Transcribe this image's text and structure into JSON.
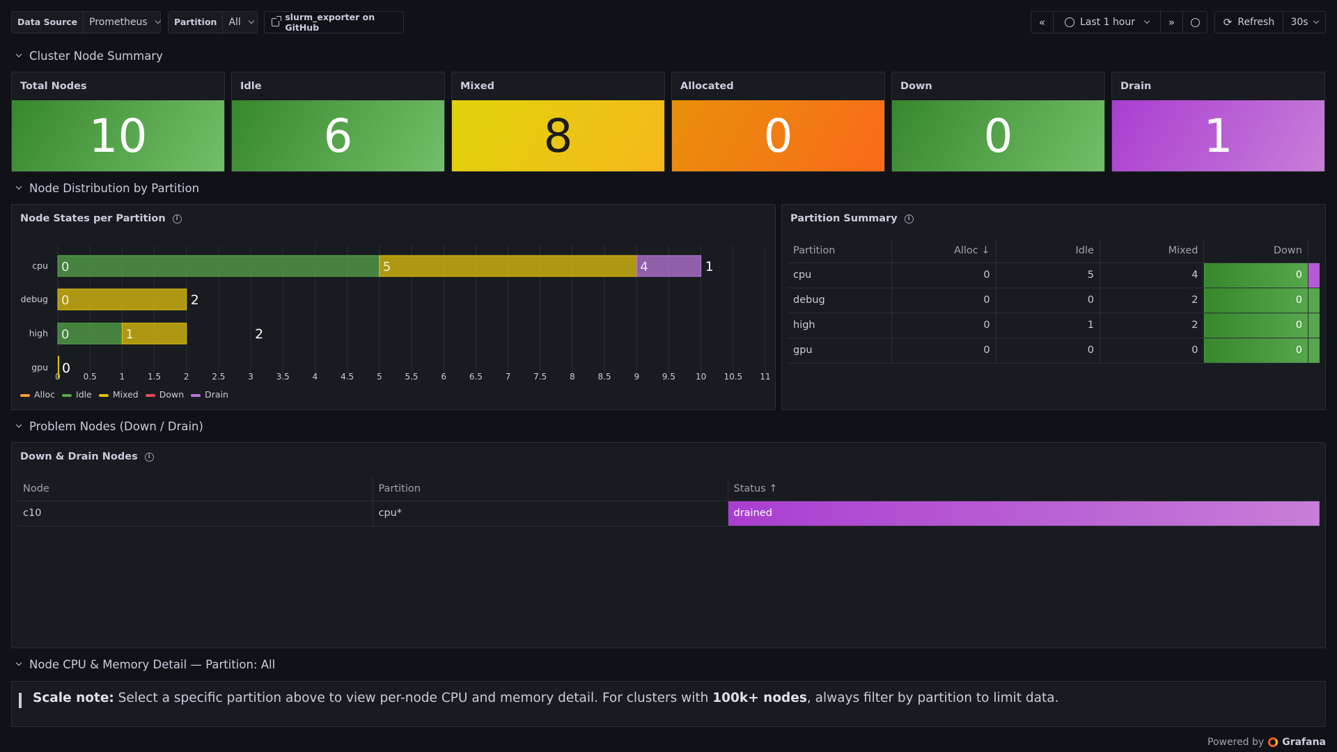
{
  "vars": {
    "datasource_label": "Data Source",
    "datasource_value": "Prometheus",
    "partition_label": "Partition",
    "partition_value": "All",
    "github_link": "slurm_exporter on GitHub"
  },
  "time": {
    "range": "Last 1 hour",
    "refresh": "Refresh",
    "interval": "30s"
  },
  "rows": {
    "summary": "Cluster Node Summary",
    "distribution": "Node Distribution by Partition",
    "problem": "Problem Nodes (Down / Drain)",
    "detail": "Node CPU & Memory Detail — Partition: All"
  },
  "stats": [
    {
      "title": "Total Nodes",
      "value": "10",
      "color": "#56a64b"
    },
    {
      "title": "Idle",
      "value": "6",
      "color": "#56a64b"
    },
    {
      "title": "Mixed",
      "value": "8",
      "color": "#f2cc0c"
    },
    {
      "title": "Allocated",
      "value": "0",
      "color": "#ff780a"
    },
    {
      "title": "Down",
      "value": "0",
      "color": "#56a64b"
    },
    {
      "title": "Drain",
      "value": "1",
      "color": "#b45ad2"
    }
  ],
  "bar_panel": {
    "title": "Node States per Partition"
  },
  "chart_data": {
    "type": "bar",
    "orientation": "horizontal",
    "stacked": true,
    "categories": [
      "cpu",
      "debug",
      "high",
      "gpu"
    ],
    "series": [
      {
        "name": "Alloc",
        "values": [
          0,
          0,
          0,
          0
        ],
        "color": "#ff9830"
      },
      {
        "name": "Idle",
        "values": [
          5,
          0,
          1,
          0
        ],
        "color": "#56a64b"
      },
      {
        "name": "Mixed",
        "values": [
          4,
          2,
          1,
          0
        ],
        "color": "#e0c10f"
      },
      {
        "name": "Down",
        "values": [
          0,
          0,
          0,
          0
        ],
        "color": "#f2495c"
      },
      {
        "name": "Drain",
        "values": [
          1,
          0,
          0,
          0
        ],
        "color": "#b877d9"
      }
    ],
    "xlim": [
      0,
      11
    ],
    "xticks": [
      "0",
      "0.5",
      "1",
      "1.5",
      "2",
      "2.5",
      "3",
      "3.5",
      "4",
      "4.5",
      "5",
      "5.5",
      "6",
      "6.5",
      "7",
      "7.5",
      "8",
      "8.5",
      "9",
      "9.5",
      "10",
      "10.5",
      "11"
    ],
    "legend": [
      "Alloc",
      "Idle",
      "Mixed",
      "Down",
      "Drain"
    ],
    "legend_position": "bottom-left"
  },
  "partition_summary": {
    "title": "Partition Summary",
    "headers": [
      "Partition",
      "Alloc",
      "Idle",
      "Mixed",
      "Down"
    ],
    "rows": [
      [
        "cpu",
        "0",
        "5",
        "4",
        "0"
      ],
      [
        "debug",
        "0",
        "0",
        "2",
        "0"
      ],
      [
        "high",
        "0",
        "1",
        "2",
        "0"
      ],
      [
        "gpu",
        "0",
        "0",
        "0",
        "0"
      ]
    ]
  },
  "problem_nodes": {
    "title": "Down & Drain Nodes",
    "headers": [
      "Node",
      "Partition",
      "Status"
    ],
    "rows": [
      [
        "c10",
        "cpu*",
        "drained"
      ]
    ]
  },
  "note": {
    "prefix": "Scale note:",
    "text1": " Select a specific partition above to view per-node CPU and memory detail. For clusters with ",
    "emph": "100k+ nodes",
    "text2": ", always filter by partition to limit data."
  },
  "footer": {
    "powered": "Powered by",
    "brand": "Grafana"
  }
}
